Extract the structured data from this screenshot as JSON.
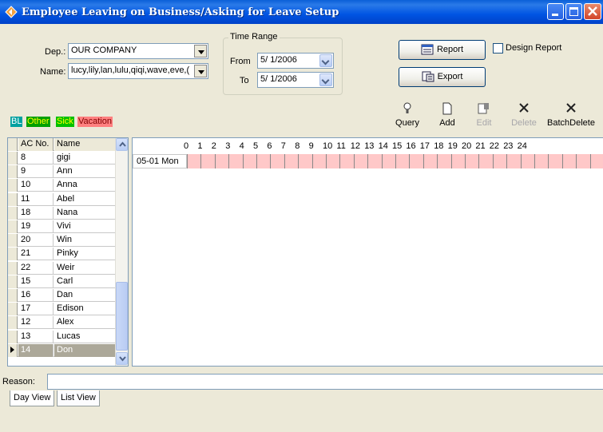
{
  "window": {
    "title": "Employee Leaving on Business/Asking for Leave Setup"
  },
  "filters": {
    "dep_label": "Dep.:",
    "dep_value": "OUR COMPANY",
    "name_label": "Name:",
    "name_value": "lucy,lily,lan,lulu,qiqi,wave,eve,(",
    "time_range_label": "Time Range",
    "from_label": "From",
    "from_value": "5/ 1/2006",
    "to_label": "To",
    "to_value": "5/ 1/2006"
  },
  "buttons": {
    "report": "Report",
    "export": "Export",
    "design_report": "Design Report"
  },
  "legend": [
    {
      "label": "BL",
      "color": "#00a0a0",
      "text": "#ffffff"
    },
    {
      "label": "Other",
      "color": "#00a000",
      "text": "#ffff00"
    },
    {
      "label": "Sick",
      "color": "#00c000",
      "text": "#ffff00"
    },
    {
      "label": "Vacation",
      "color": "#ff8080",
      "text": "#800000"
    }
  ],
  "toolbar": {
    "query": "Query",
    "add": "Add",
    "edit": "Edit",
    "delete": "Delete",
    "batch_delete": "BatchDelete"
  },
  "employee_table": {
    "headers": [
      "AC No.",
      "Name"
    ],
    "rows": [
      {
        "ac": "8",
        "name": "gigi"
      },
      {
        "ac": "9",
        "name": "Ann"
      },
      {
        "ac": "10",
        "name": "Anna"
      },
      {
        "ac": "11",
        "name": "Abel"
      },
      {
        "ac": "18",
        "name": "Nana"
      },
      {
        "ac": "19",
        "name": "Vivi"
      },
      {
        "ac": "20",
        "name": "Win"
      },
      {
        "ac": "21",
        "name": "Pinky"
      },
      {
        "ac": "22",
        "name": "Weir"
      },
      {
        "ac": "15",
        "name": "Carl"
      },
      {
        "ac": "16",
        "name": "Dan"
      },
      {
        "ac": "17",
        "name": "Edison"
      },
      {
        "ac": "12",
        "name": "Alex"
      },
      {
        "ac": "13",
        "name": "Lucas"
      },
      {
        "ac": "14",
        "name": "Don"
      }
    ],
    "selected_index": 14
  },
  "schedule": {
    "hours": [
      "0",
      "1",
      "2",
      "3",
      "4",
      "5",
      "6",
      "7",
      "8",
      "9",
      "10",
      "11",
      "12",
      "13",
      "14",
      "15",
      "16",
      "17",
      "18",
      "19",
      "20",
      "21",
      "22",
      "23",
      "24"
    ],
    "days": [
      "05-01 Mon"
    ],
    "cell_color": "#ffc8c8"
  },
  "reason": {
    "label": "Reason:",
    "value": ""
  },
  "tabs": [
    {
      "label": "Day View",
      "active": true
    },
    {
      "label": "List View",
      "active": false
    }
  ]
}
